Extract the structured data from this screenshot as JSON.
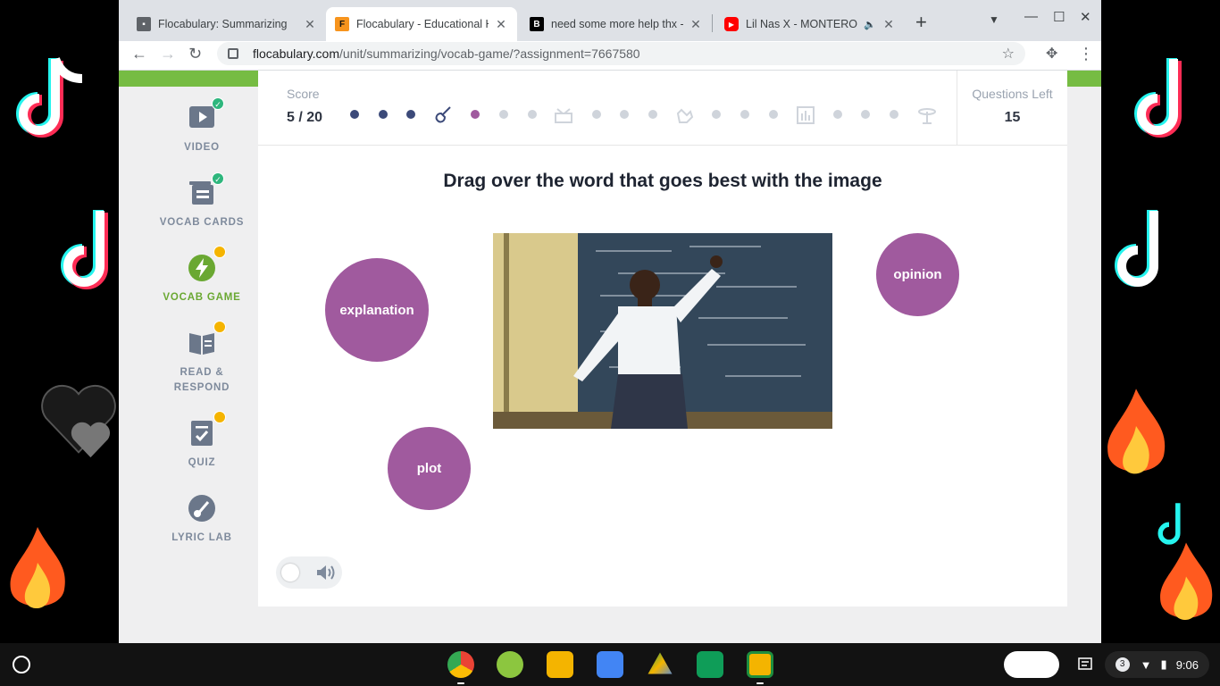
{
  "browser": {
    "tabs": [
      {
        "title": "Flocabulary: Summarizing",
        "favicon": "classroom-icon",
        "active": false
      },
      {
        "title": "Flocabulary - Educational Hi",
        "favicon": "flocabulary-icon",
        "active": true
      },
      {
        "title": "need some more help thx - Br",
        "favicon": "brainly-icon",
        "active": false
      },
      {
        "title": "Lil Nas X - MONTERO (Ca",
        "favicon": "youtube-icon",
        "active": false
      }
    ],
    "url_host": "flocabulary.com",
    "url_path": "/unit/summarizing/vocab-game/?assignment=7667580"
  },
  "sidebar": {
    "items": [
      {
        "label": "VIDEO",
        "status": "complete"
      },
      {
        "label": "VOCAB CARDS",
        "status": "complete"
      },
      {
        "label": "VOCAB GAME",
        "status": "current"
      },
      {
        "label": "READ &",
        "label2": "RESPOND",
        "status": "pending"
      },
      {
        "label": "QUIZ",
        "status": "pending"
      },
      {
        "label": "LYRIC LAB",
        "status": "none"
      }
    ]
  },
  "game": {
    "score_label": "Score",
    "score_value": "5 / 20",
    "questions_left_label": "Questions Left",
    "questions_left_value": "15",
    "prompt": "Drag over the word that goes best with the image",
    "words": [
      "explanation",
      "opinion",
      "plot"
    ],
    "image_subject": "teacher pointing at chalkboard"
  },
  "colors": {
    "accent_green": "#76bc43",
    "word_purple": "#a05a9e",
    "progress_done": "#3c4a79"
  },
  "shelf": {
    "notification_count": "3",
    "time": "9:06"
  }
}
